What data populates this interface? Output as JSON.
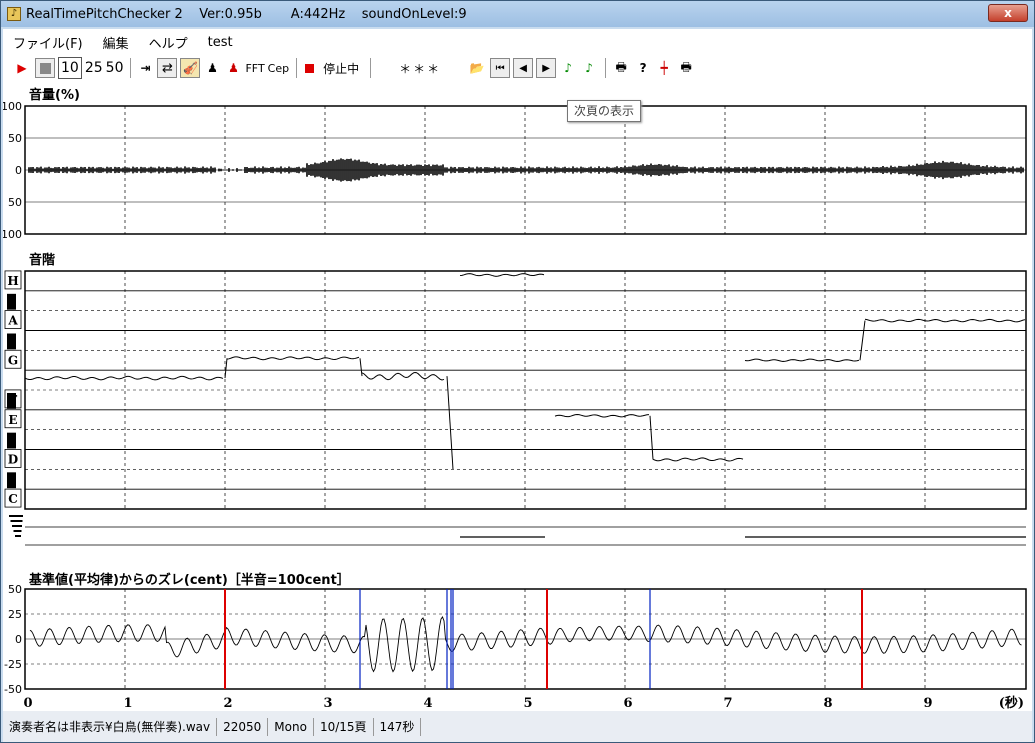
{
  "window": {
    "title": "RealTimePitchChecker 2    Ver:0.95b       A:442Hz    soundOnLevel:9",
    "close_label": "x"
  },
  "menu": [
    "ファイル(F)",
    "編集",
    "ヘルプ",
    "test"
  ],
  "toolbar": {
    "speeds": [
      "10",
      "25",
      "50"
    ],
    "fft": "FFT",
    "cep": "Cep",
    "status": "停止中",
    "display": "＊＊＊"
  },
  "tooltip": "次頁の表示",
  "panels": {
    "volume": {
      "label": "音量(%)",
      "ticks": [
        "100",
        "50",
        "0",
        "50",
        "100"
      ]
    },
    "scale": {
      "label": "音階",
      "notes": [
        "H",
        "A",
        "G",
        "F",
        "E",
        "D",
        "C"
      ]
    },
    "cent": {
      "label": "基準値(平均律)からのズレ(cent)［半音=100cent］",
      "ticks": [
        "50",
        "25",
        "0",
        "-25",
        "-50"
      ]
    },
    "time": {
      "ticks": [
        "0",
        "1",
        "2",
        "3",
        "4",
        "5",
        "6",
        "7",
        "8",
        "9"
      ],
      "unit": "(秒)"
    }
  },
  "status_bar": [
    "演奏者名は非表示¥白鳥(無伴奏).wav",
    "22050",
    "Mono",
    "10/15頁",
    "147秒"
  ]
}
